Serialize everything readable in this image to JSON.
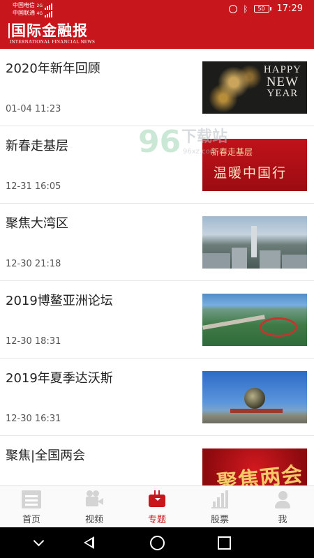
{
  "status_bar": {
    "carrier_1": "中国电信",
    "carrier_1_net": "2G",
    "carrier_2": "中国联通",
    "carrier_2_net": "4G",
    "battery": "50",
    "time": "17:29"
  },
  "header": {
    "brand_cn": "国际金融报",
    "brand_en": "INTERNATIONAL FINANCIAL NEWS",
    "background_color": "#c8161d"
  },
  "articles": [
    {
      "title": "2020年新年回顾",
      "time": "01-04 11:23",
      "thumb_text": [
        "HAPPY",
        "NEW",
        "YEAR"
      ]
    },
    {
      "title": "新春走基层",
      "time": "12-31 16:05",
      "thumb_text": [
        "新春走基层",
        "温暖中国行"
      ]
    },
    {
      "title": "聚焦大湾区",
      "time": "12-30 21:18"
    },
    {
      "title": "2019博鳌亚洲论坛",
      "time": "12-30 18:31"
    },
    {
      "title": "2019年夏季达沃斯",
      "time": "12-30 16:31"
    },
    {
      "title": "聚焦|全国两会",
      "time": "",
      "thumb_text": [
        "聚焦两会"
      ]
    }
  ],
  "watermark": {
    "number": "96",
    "text": "下载站",
    "url": "96xz.com"
  },
  "tabbar": {
    "items": [
      {
        "label": "首页",
        "icon": "home-icon"
      },
      {
        "label": "视频",
        "icon": "video-camera-icon"
      },
      {
        "label": "专题",
        "icon": "tv-icon",
        "active": true
      },
      {
        "label": "股票",
        "icon": "bar-chart-icon"
      },
      {
        "label": "我",
        "icon": "user-icon"
      }
    ],
    "active_color": "#c8161d"
  }
}
